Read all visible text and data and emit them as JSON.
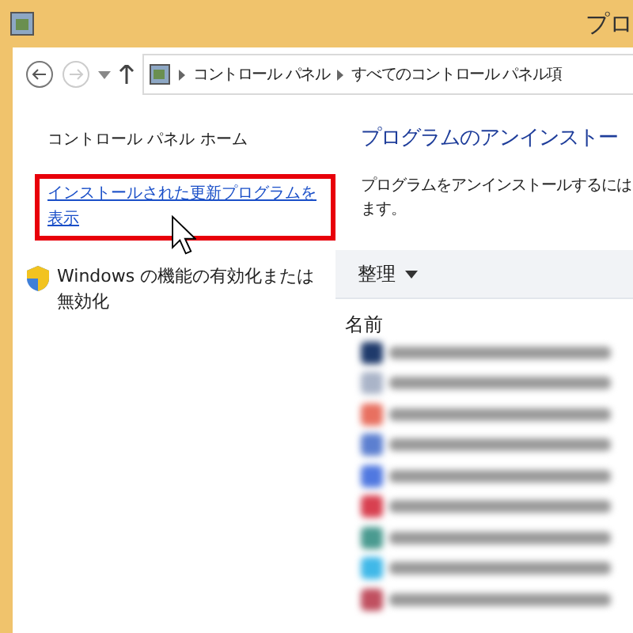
{
  "window": {
    "title": "プロ"
  },
  "navigation": {
    "breadcrumbs": [
      "コントロール パネル",
      "すべてのコントロール パネル項"
    ]
  },
  "sidebar": {
    "items": [
      {
        "kind": "plain",
        "label": "コントロール パネル ホーム",
        "highlighted": false
      },
      {
        "kind": "link",
        "label": "インストールされた更新プログラムを表示",
        "highlighted": true
      },
      {
        "kind": "shield",
        "label": "Windows の機能の有効化または無効化",
        "highlighted": false
      }
    ]
  },
  "content": {
    "heading": "プログラムのアンインストー",
    "description": [
      "プログラムをアンインストールするには",
      "ます。"
    ],
    "toolbar": {
      "organize": "整理"
    },
    "list": {
      "column": "名前",
      "rows": [
        {
          "color": "#1f3a6b"
        },
        {
          "color": "#aab4c8"
        },
        {
          "color": "#e87060"
        },
        {
          "color": "#5c7fd0"
        },
        {
          "color": "#5078e0"
        },
        {
          "color": "#d84050"
        },
        {
          "color": "#4a9a90"
        },
        {
          "color": "#40b8e8"
        },
        {
          "color": "#c05060"
        }
      ]
    }
  }
}
